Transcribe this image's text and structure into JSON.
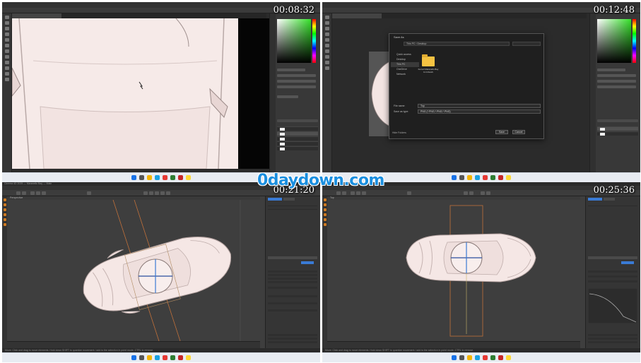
{
  "timestamps": [
    "00:08:32",
    "00:12:48",
    "00:21:20",
    "00:25:36"
  ],
  "watermark": "0daydown.com",
  "colors": {
    "ps_dark": "#2b2b2b",
    "car_body": "#f6eae8",
    "accent_blue": "#1a8fe0",
    "c4d_orange": "#d07a20",
    "guide_orange": "#c0703a"
  },
  "quad1": {
    "app": "photoshop",
    "icons": [
      "cursor-icon",
      "color-picker-icon",
      "layers-icon"
    ]
  },
  "quad2": {
    "app": "photoshop",
    "dialog": {
      "title": "Save As",
      "address": "This PC › Desktop",
      "nav_items": [
        "Quick access",
        "Desktop",
        "This PC",
        "OneDrive",
        "Network"
      ],
      "folder_label": "Ferrari Maranello Bay 11 Artwork",
      "file_name_label": "File name:",
      "file_name_value": "Top",
      "save_type_label": "Save as type:",
      "save_type_value": "PNG (*.PNG;*.PNG;*.PNG)",
      "hide_folders": "Hide Folders",
      "buttons": [
        "Save",
        "Cancel"
      ]
    }
  },
  "quad3": {
    "app": "cinema4d",
    "title": "Cinema 4D 2025 — Maranello Bay — Main",
    "view_label": "Perspective",
    "status": "Move: Click and drag to move elements. Hold down SHIFT to quantize movement / add to the selection in point mode, CTRL to remove."
  },
  "quad4": {
    "app": "cinema4d",
    "view_label": "Top",
    "status": "Move: Click and drag to move elements. Hold down SHIFT to quantize movement / add to the selection in point mode, CTRL to remove."
  }
}
